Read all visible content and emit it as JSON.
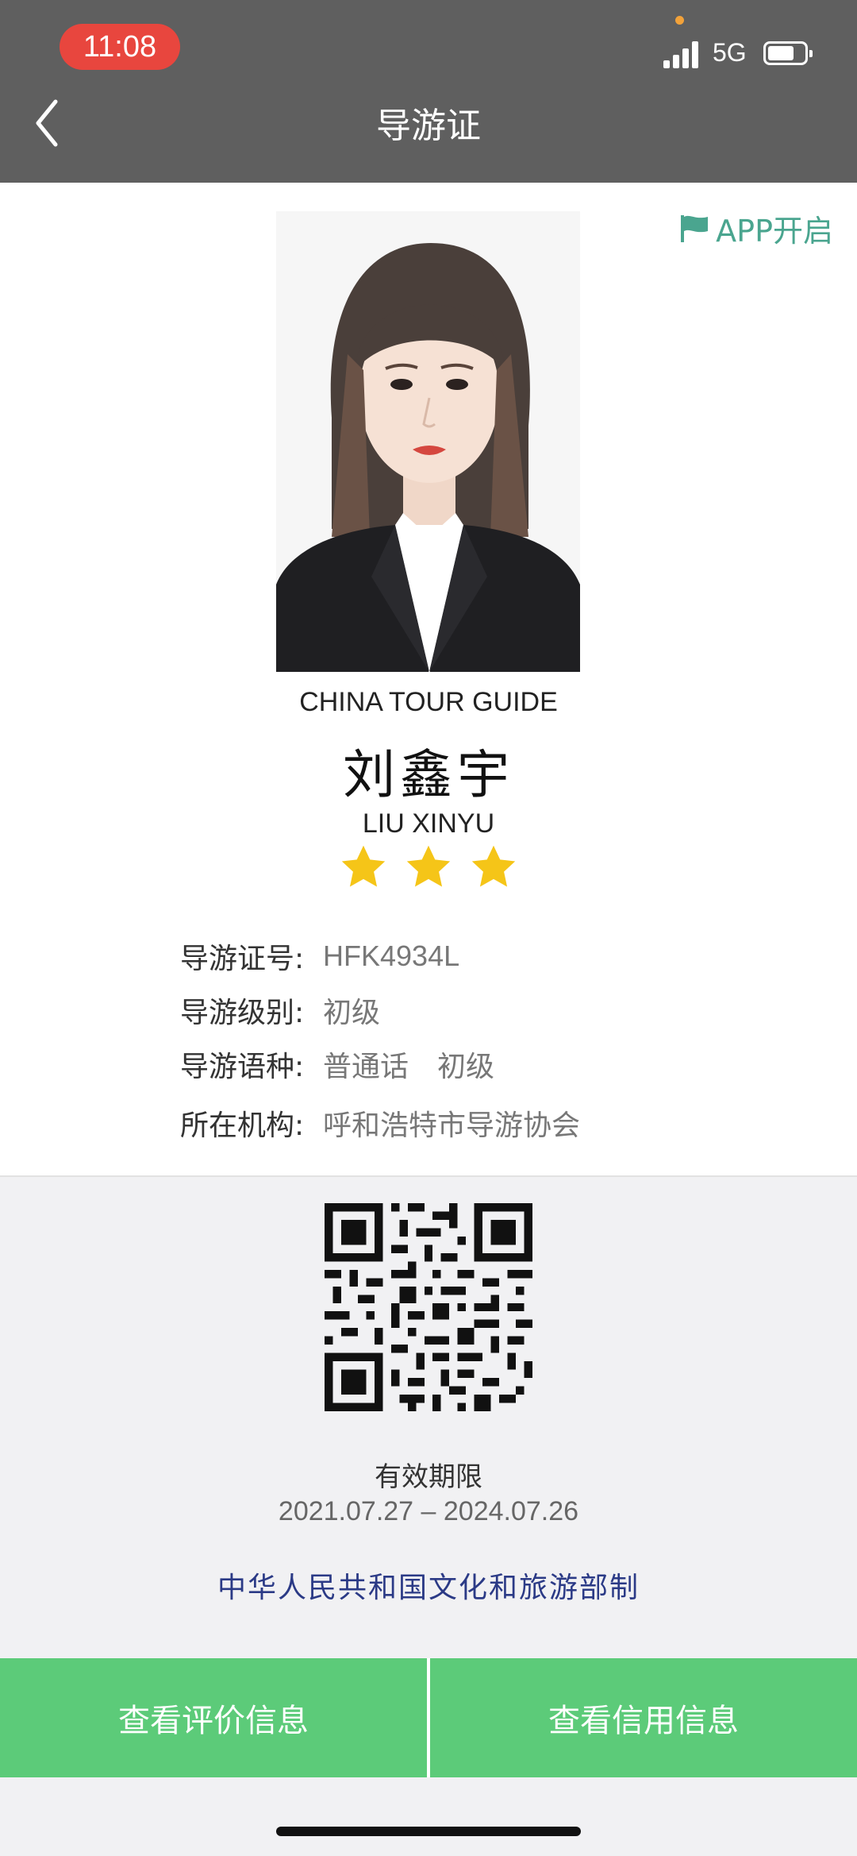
{
  "status_bar": {
    "time": "11:08",
    "network": "5G"
  },
  "nav": {
    "title": "导游证"
  },
  "card": {
    "app_open_label": "APP开启",
    "english_title": "CHINA TOUR GUIDE",
    "name_cn": "刘鑫宇",
    "name_en": "LIU XINYU",
    "star_rating": 3,
    "fields": [
      {
        "key": "导游证号:",
        "value": "HFK4934L"
      },
      {
        "key": "导游级别:",
        "value": "初级"
      },
      {
        "key": "导游语种:",
        "value": "普通话　初级"
      },
      {
        "key": "所在机构:",
        "value": "呼和浩特市导游协会"
      }
    ]
  },
  "validity": {
    "label": "有效期限",
    "range": "2021.07.27 – 2024.07.26"
  },
  "issuer": "中华人民共和国文化和旅游部制",
  "actions": {
    "reviews": "查看评价信息",
    "credit": "查看信用信息"
  },
  "colors": {
    "header": "#5f5f5f",
    "accent_green": "#5ccb79",
    "app_open": "#4aa58f",
    "issuer_blue": "#2b3a86",
    "star": "#f5c518",
    "time_pill": "#e8463e"
  }
}
